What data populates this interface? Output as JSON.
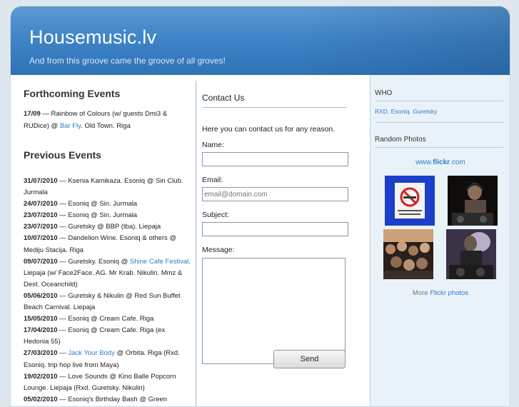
{
  "header": {
    "site_title": "Housemusic.lv",
    "tagline": "And from this groove came the groove of all groves!"
  },
  "forthcoming": {
    "title": "Forthcoming Events",
    "events": [
      {
        "date": "17/09",
        "pre": " — Rainbow of Colours (w/ guests Dmi3 & RUDice) @ ",
        "link": "Bar Fly",
        "post": ". Old Town. Riga"
      }
    ]
  },
  "previous": {
    "title": "Previous Events",
    "events": [
      {
        "date": "31/07/2010",
        "pre": " — Ksenia Kamikaza. Esoniq @ Sin Club. Jurmala",
        "link": "",
        "post": ""
      },
      {
        "date": "24/07/2010",
        "pre": " — Esoniq @ Sin. Jurmala",
        "link": "",
        "post": ""
      },
      {
        "date": "23/07/2010",
        "pre": " — Esoniq @ Sin. Jurmala",
        "link": "",
        "post": ""
      },
      {
        "date": "23/07/2010",
        "pre": " — Guretsky @ BBP (tba). Liepaja",
        "link": "",
        "post": ""
      },
      {
        "date": "10/07/2010",
        "pre": " — Dandelion Wine. Esoniq & others @ Mediju Stacija. Riga",
        "link": "",
        "post": ""
      },
      {
        "date": "09/07/2010",
        "pre": " — Guretsky. Esoniq @ ",
        "link": "Shine Cafe Festival",
        "post": ". Liepaja (w/ Face2Face. AG. Mr Krab. Nikulin. Mmz & Dest. Oceanchild)"
      },
      {
        "date": "05/06/2010",
        "pre": " — Guretsky & Nikulin @ Red Sun Buffet Beach Carnival. Liepaja",
        "link": "",
        "post": ""
      },
      {
        "date": "15/05/2010",
        "pre": " — Esoniq @ Cream Cafe. Riga",
        "link": "",
        "post": ""
      },
      {
        "date": "17/04/2010",
        "pre": " — Esoniq @ Cream Cafe. Riga (ex Hedonia 55)",
        "link": "",
        "post": ""
      },
      {
        "date": "27/03/2010",
        "pre": " — ",
        "link": "Jack Your Body",
        "post": " @ Orbita. Riga (Rxd. Esoniq. trip hop live from Maya)"
      },
      {
        "date": "19/02/2010",
        "pre": " — Love Sounds @ Kino Balle Popcorn Lounge. Liepaja (Rxd. Guretsky. Nikulin)",
        "link": "",
        "post": ""
      },
      {
        "date": "05/02/2010",
        "pre": " — Esoniq's Birthday Bash @ Green",
        "link": "",
        "post": ""
      }
    ]
  },
  "contact": {
    "title": "Contact Us",
    "intro": "Here you can contact us for any reason.",
    "name_label": "Name:",
    "name_value": "",
    "email_label": "Email:",
    "email_placeholder": "email@domain.com",
    "subject_label": "Subject:",
    "subject_value": "",
    "message_label": "Message:",
    "send_label": "Send"
  },
  "sidebar": {
    "who_title": "WHO",
    "who_names": "RXD. Esoniq. Guretsky",
    "photos_title": "Random Photos",
    "flickr_www": "www.",
    "flickr_brand": "flickr",
    "flickr_com": ".com",
    "more_prefix": "More ",
    "more_link": "Flickr photos"
  },
  "colors": {
    "header_blue": "#3f85c8",
    "link_blue": "#2f7cc9",
    "sidebar_bg": "#eaf2f9"
  }
}
